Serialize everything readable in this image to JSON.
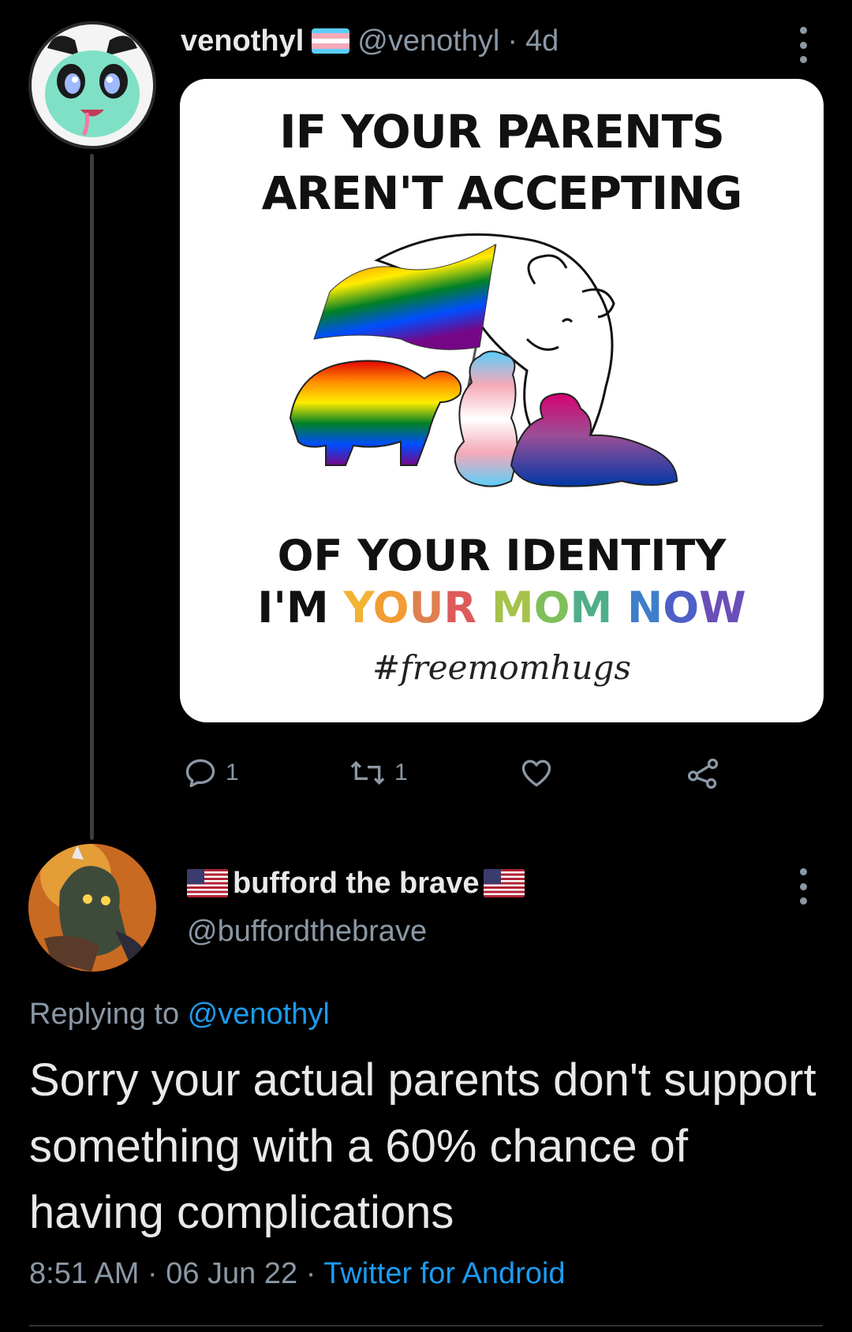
{
  "tweet": {
    "display_name": "venothyl",
    "handle": "@venothyl",
    "separator": "·",
    "age": "4d",
    "name_flag_icon": "transgender-flag-icon",
    "media": {
      "top_line_1": "IF YOUR PARENTS",
      "top_line_2": "AREN'T ACCEPTING",
      "bottom_line_1": "OF YOUR IDENTITY",
      "bottom_line_2_words": [
        "I'M",
        "YOUR",
        "MOM",
        "NOW"
      ],
      "bottom_line_2_letters": [
        "I'M ",
        "Y",
        "O",
        "U",
        "R ",
        "M",
        "O",
        "M ",
        "N",
        "O",
        "W"
      ],
      "hashtag": "#freemomhugs"
    },
    "actions": {
      "reply_count": "1",
      "retweet_count": "1",
      "like_count": "",
      "share_icon": "share-icon"
    }
  },
  "reply": {
    "display_name": "bufford the brave",
    "name_flag_icon": "us-flag-icon",
    "handle": "@buffordthebrave",
    "replying_prefix": "Replying to",
    "replying_mention": "@venothyl",
    "text": "Sorry your actual parents don't support something with a 60% chance of having complications",
    "time": "8:51 AM",
    "separator": "·",
    "date": "06 Jun 22",
    "separator2": "·",
    "source": "Twitter for Android"
  },
  "colors": {
    "background": "#000000",
    "text_primary": "#e7e9ea",
    "text_secondary": "#8b98a5",
    "link": "#1d9bf0",
    "trans_blue": "#5bcefa",
    "trans_pink": "#f5a9b8",
    "trans_white": "#ffffff",
    "rainbow": [
      "#e40303",
      "#ff8c00",
      "#ffed00",
      "#008026",
      "#004dff",
      "#750787"
    ]
  }
}
